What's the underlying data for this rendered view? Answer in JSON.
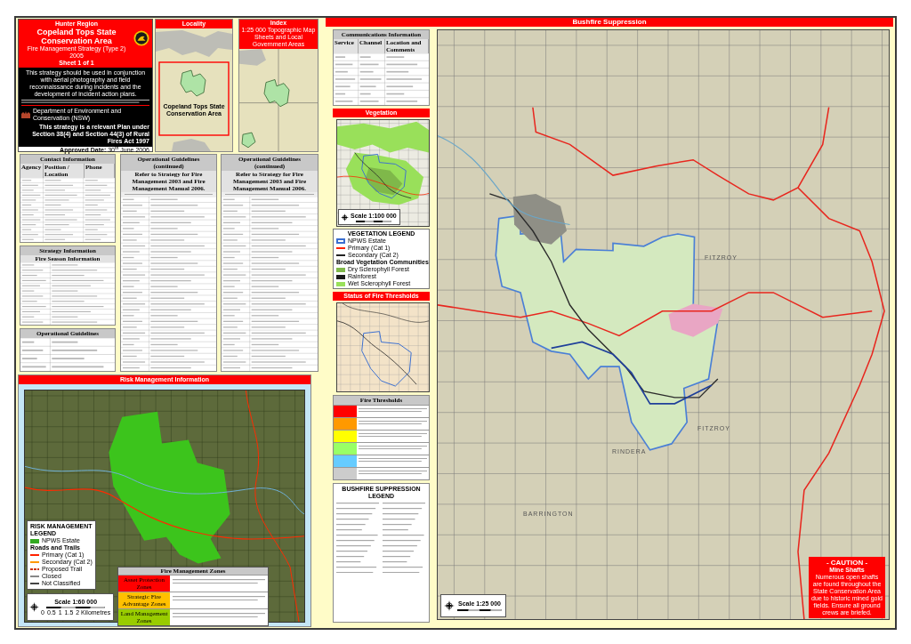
{
  "title_block": {
    "region": "Hunter Region",
    "title": "Copeland Tops State Conservation Area",
    "strategy": "Fire Management Strategy (Type 2)",
    "year": "2005",
    "sheet": "Sheet 1 of 1",
    "usage_note": "This strategy should be used in conjunction with aerial photography and field reconnaissance during incidents and the development of incident action plans.",
    "department": "Department of Environment and Conservation (NSW)",
    "plan_note": "This strategy is a relevant Plan under Section 38(4) and Section 44(3) of Rural Fires Act 1997",
    "approved": "**Approved Date:** 30$^{th}$ June 2006"
  },
  "locality": {
    "title": "Locality",
    "map_label": "Copeland Tops State Conservation Area"
  },
  "index": {
    "title": "Index",
    "subtitle": "1:25 000 Topographic Map Sheets and Local Government Areas"
  },
  "contact": {
    "title": "Contact Information",
    "columns": [
      "Agency",
      "Position / Location",
      "Phone"
    ]
  },
  "strategy_info": {
    "title": "Strategy Information",
    "subtitle": "Fire Season Information"
  },
  "guidelines": {
    "title": "Operational Guidelines"
  },
  "guidelines_continued": [
    {
      "title": "Operational Guidelines (continued)",
      "subtitle": "Refer to Strategy for Fire Management 2003 and Fire Management Manual 2006."
    },
    {
      "title": "Operational Guidelines (continued)",
      "subtitle": "Refer to Strategy for Fire Management 2003 and Fire Management Manual 2006."
    }
  ],
  "risk": {
    "title": "Risk Management Information",
    "legend_title": "RISK MANAGEMENT LEGEND",
    "legend": [
      {
        "label": "NPWS Estate",
        "kind": "area",
        "color": "#33aa22"
      },
      {
        "label": "Roads and Trails",
        "kind": "heading"
      },
      {
        "label": "Primary (Cat 1)",
        "kind": "line",
        "color": "#ff2200"
      },
      {
        "label": "Secondary (Cat 2)",
        "kind": "line",
        "color": "#ff9900"
      },
      {
        "label": "Proposed Trail",
        "kind": "dashed",
        "color": "#cc3300"
      },
      {
        "label": "Closed",
        "kind": "line",
        "color": "#888888"
      },
      {
        "label": "Not Classified",
        "kind": "line",
        "color": "#444444"
      }
    ],
    "scale": "Scale 1:60 000",
    "scale_ticks": [
      "0",
      "0.5",
      "1",
      "1.5",
      "2 Kilometres"
    ],
    "zones_title": "Fire Management Zones",
    "zones": [
      {
        "label": "Asset Protection Zones",
        "color": "#ff0000"
      },
      {
        "label": "Strategic Fire Advantage Zones",
        "color": "#ffc000"
      },
      {
        "label": "Land Management Zones",
        "color": "#99cc00"
      }
    ]
  },
  "suppression": {
    "title": "Bushfire Suppression",
    "communications": {
      "title": "Communications Information",
      "columns": [
        "Service",
        "Channel",
        "Location and Comments"
      ]
    },
    "vegetation": {
      "title": "Vegetation",
      "scale": "Scale 1:100 000",
      "legend_title": "VEGETATION LEGEND",
      "legend": [
        {
          "label": "NPWS Estate",
          "kind": "outline",
          "color": "#3b6fd0"
        },
        {
          "label": "Primary (Cat 1)",
          "kind": "line",
          "color": "#ff2200"
        },
        {
          "label": "Secondary (Cat 2)",
          "kind": "line",
          "color": "#222222"
        },
        {
          "label": "Broad Vegetation Communities",
          "kind": "heading"
        },
        {
          "label": "Dry Sclerophyll Forest",
          "kind": "area",
          "color": "#7fb84a"
        },
        {
          "label": "Rainforest",
          "kind": "area",
          "color": "#1a1a1a"
        },
        {
          "label": "Wet Sclerophyll Forest",
          "kind": "area",
          "color": "#99e05a"
        }
      ]
    },
    "thresholds": {
      "title": "Status of Fire Thresholds",
      "table_title": "Fire Thresholds",
      "levels": [
        {
          "color": "#ff0000"
        },
        {
          "color": "#ff9900"
        },
        {
          "color": "#ffff00"
        },
        {
          "color": "#99ff66"
        },
        {
          "color": "#66ccff"
        },
        {
          "color": "#cccccc"
        }
      ]
    },
    "legend_title": "BUSHFIRE SUPPRESSION LEGEND",
    "scale": "Scale 1:25 000",
    "place_labels": [
      "FITZROY",
      "FITZROY",
      "RINDERA",
      "BARRINGTON"
    ],
    "caution": {
      "title": "- CAUTION -",
      "subtitle": "Mine Shafts",
      "text": "Numerous open shafts are found throughout the State Conservation Area due to historic mined gold fields. Ensure all ground crews are briefed."
    }
  }
}
